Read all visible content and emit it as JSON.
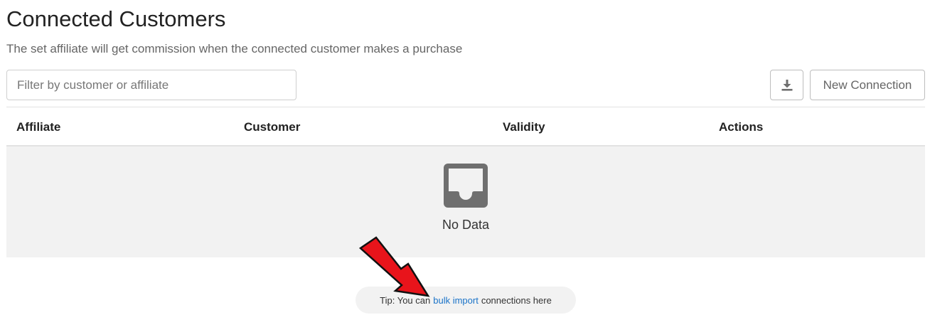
{
  "header": {
    "title": "Connected Customers",
    "subtitle": "The set affiliate will get commission when the connected customer makes a purchase"
  },
  "toolbar": {
    "filter_placeholder": "Filter by customer or affiliate",
    "filter_value": "",
    "export_icon": "download-icon",
    "new_connection_label": "New Connection"
  },
  "table": {
    "columns": [
      "Affiliate",
      "Customer",
      "Validity",
      "Actions"
    ],
    "empty_icon": "inbox-icon",
    "empty_text": "No Data"
  },
  "tip": {
    "prefix": "Tip: You can",
    "link_text": "bulk import",
    "suffix": "connections here"
  },
  "annotation": {
    "arrow_icon": "red-arrow-icon",
    "arrow_color": "#e8141b"
  },
  "colors": {
    "link": "#1a73c8",
    "empty_background": "#f2f2f2",
    "icon_gray": "#6f6f6f"
  }
}
